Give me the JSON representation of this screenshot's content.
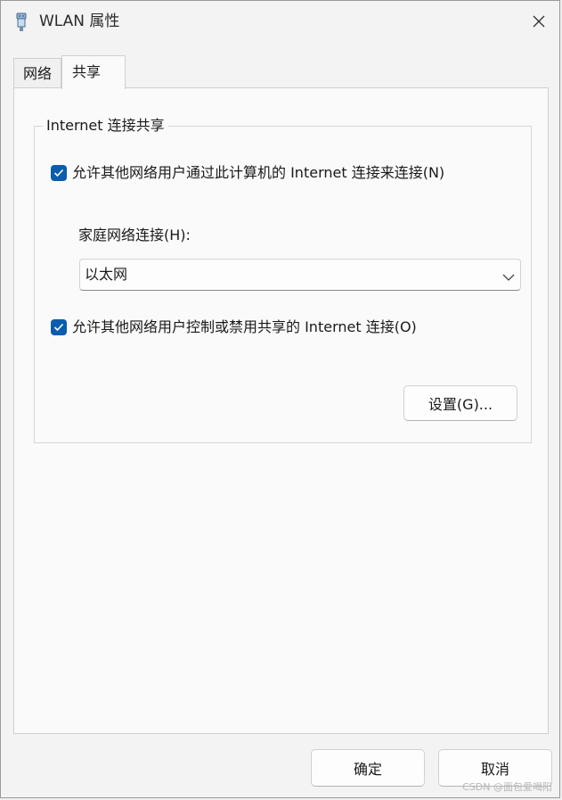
{
  "window": {
    "title": "WLAN 属性",
    "close_icon": "close-icon"
  },
  "tabs": [
    {
      "label": "网络",
      "active": false
    },
    {
      "label": "共享",
      "active": true
    }
  ],
  "sharing": {
    "group_title": "Internet 连接共享",
    "allow_sharing": {
      "label": "允许其他网络用户通过此计算机的 Internet 连接来连接(N)",
      "checked": true
    },
    "home_network_label": "家庭网络连接(H):",
    "home_network_select": {
      "value": "以太网"
    },
    "allow_control": {
      "label": "允许其他网络用户控制或禁用共享的 Internet 连接(O)",
      "checked": true
    },
    "settings_button": "设置(G)..."
  },
  "footer": {
    "ok_button": "确定",
    "cancel_button": "取消"
  },
  "watermark": "CSDN @面包爱喝阳",
  "colors": {
    "accent": "#0b5cad",
    "window_bg": "#f3f3f3",
    "panel_bg": "#fafafa"
  }
}
